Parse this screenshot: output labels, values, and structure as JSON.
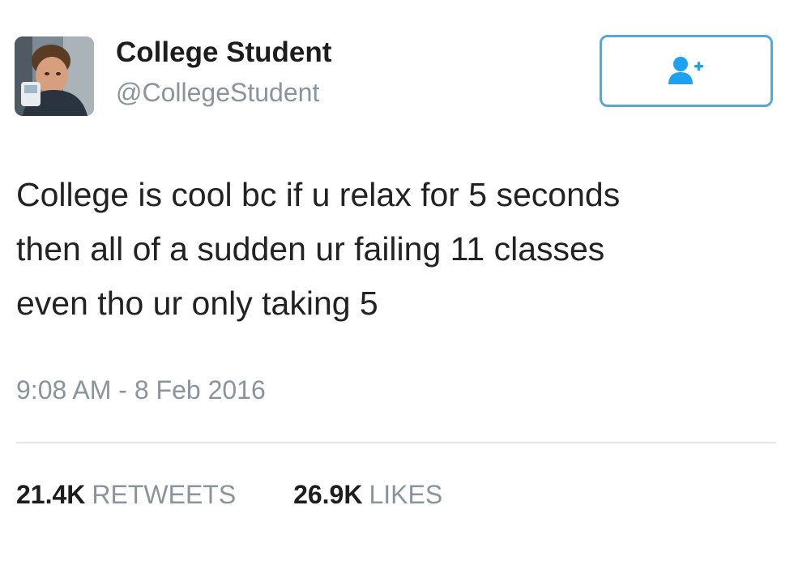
{
  "author": {
    "display_name": "College Student",
    "handle": "@CollegeStudent",
    "avatar_icon": "profile-photo"
  },
  "follow_button": {
    "icon": "follow-user-icon",
    "color": "#1da1f2"
  },
  "tweet": {
    "lines": [
      "College is cool bc if u relax for 5 seconds",
      "then all of a sudden ur failing 11 classes",
      "even tho ur only taking 5"
    ],
    "timestamp": "9:08 AM - 8 Feb 2016"
  },
  "stats": {
    "retweets_count": "21.4K",
    "retweets_label": "RETWEETS",
    "likes_count": "26.9K",
    "likes_label": "LIKES"
  },
  "colors": {
    "accent": "#1da1f2",
    "muted_text": "#8a949c",
    "divider": "#e3e6e8"
  }
}
